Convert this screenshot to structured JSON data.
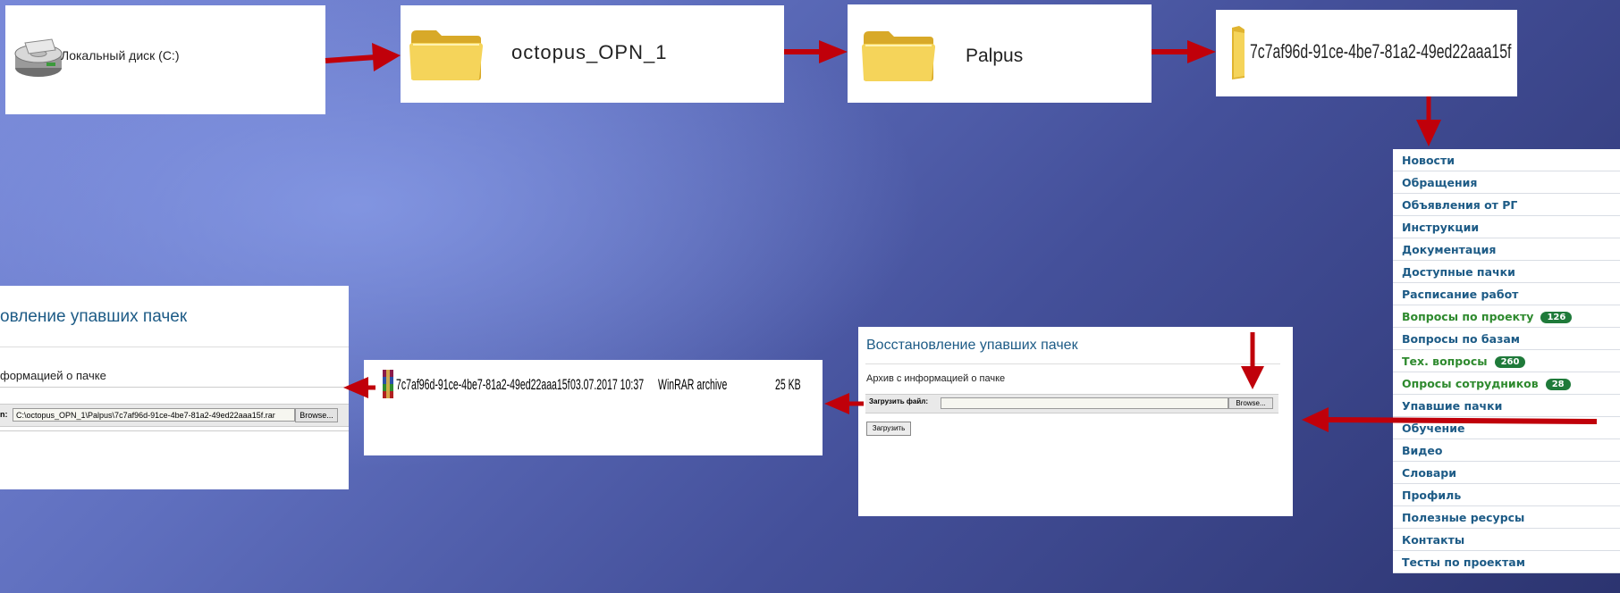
{
  "steps": {
    "drive_label": "Локальный диск (C:)",
    "folder1": "octopus_OPN_1",
    "folder2": "Palpus",
    "folder3": "7c7af96d-91ce-4be7-81a2-49ed22aaa15f"
  },
  "menu": {
    "items": [
      {
        "label": "Новости"
      },
      {
        "label": "Обращения"
      },
      {
        "label": "Объявления от РГ"
      },
      {
        "label": "Инструкции"
      },
      {
        "label": "Документация"
      },
      {
        "label": "Доступные пачки"
      },
      {
        "label": "Расписание работ"
      },
      {
        "label": "Вопросы по проекту",
        "badge": "126",
        "color": "green"
      },
      {
        "label": "Вопросы по базам"
      },
      {
        "label": "Тех. вопросы",
        "badge": "260",
        "color": "green"
      },
      {
        "label": "Опросы сотрудников",
        "badge": "28",
        "color": "green"
      },
      {
        "label": "Упавшие пачки"
      },
      {
        "label": "Обучение"
      },
      {
        "label": "Видео"
      },
      {
        "label": "Словари"
      },
      {
        "label": "Профиль"
      },
      {
        "label": "Полезные ресурсы"
      },
      {
        "label": "Контакты"
      },
      {
        "label": "Тесты по проектам"
      }
    ]
  },
  "upload_form": {
    "title": "Восстановление упавших пачек",
    "subtitle": "Архив с информацией о пачке",
    "file_label": "Загрузить файл:",
    "browse_label": "Browse...",
    "upload_label": "Загрузить"
  },
  "file_listing": {
    "name": "7c7af96d-91ce-4be7-81a2-49ed22aaa15f",
    "date": "03.07.2017 10:37",
    "type": "WinRAR archive",
    "size": "25 KB"
  },
  "result_form": {
    "title": "овление упавших пачек",
    "subtitle": "формацией о пачке",
    "file_label": "n:",
    "file_value": "C:\\octopus_OPN_1\\Palpus\\7c7af96d-91ce-4be7-81a2-49ed22aaa15f.rar",
    "browse_label": "Browse..."
  },
  "colors": {
    "arrow": "#c0000a",
    "link": "#1d5b86",
    "badge": "#1f7a3a"
  }
}
